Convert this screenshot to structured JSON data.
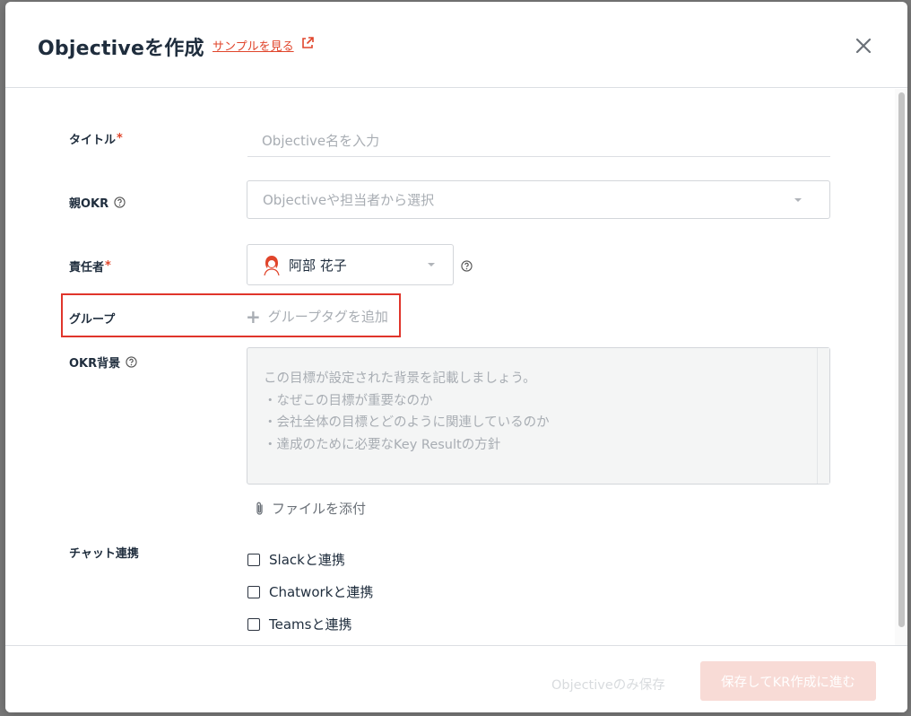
{
  "modal": {
    "title": "Objectiveを作成",
    "sample_link": "サンプルを見る"
  },
  "form": {
    "title_label": "タイトル",
    "title_placeholder": "Objective名を入力",
    "parent_label": "親OKR",
    "parent_placeholder": "Objectiveや担当者から選択",
    "owner_label": "責任者",
    "owner_value": "阿部 花子",
    "group_label": "グループ",
    "group_add": "グループタグを追加",
    "background_label": "OKR背景",
    "background_placeholder_lines": [
      "この目標が設定された背景を記載しましょう。",
      "・なぜこの目標が重要なのか",
      "・会社全体の目標とどのように関連しているのか",
      "・達成のために必要なKey Resultの方針"
    ],
    "attach_label": "ファイルを添付",
    "chat_label": "チャット連携",
    "chat_options": [
      "Slackと連携",
      "Chatworkと連携",
      "Teamsと連携"
    ],
    "required_mark": "*"
  },
  "footer": {
    "save_only": "Objectiveのみ保存",
    "save_next": "保存してKR作成に進む"
  },
  "colors": {
    "accent": "#e0452b",
    "highlight_border": "#e0352b"
  }
}
